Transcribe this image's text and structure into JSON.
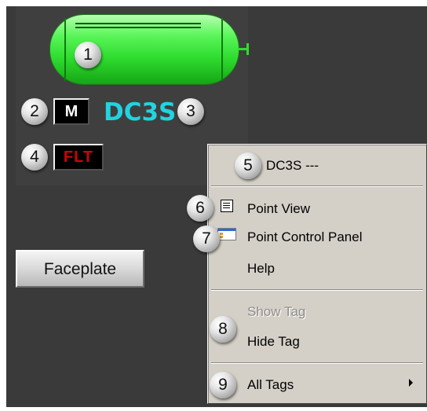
{
  "tank": {
    "color": "#3ee63e",
    "callout": "1"
  },
  "mode": {
    "button_label": "M",
    "callout": "2"
  },
  "tag": {
    "name": "DC3S",
    "color": "#22d3e0",
    "callout": "3"
  },
  "fault": {
    "button_label": "FLT",
    "text_color": "#d40000",
    "callout": "4"
  },
  "faceplate": {
    "label": "Faceplate"
  },
  "context_menu": {
    "title": "DC3S ---",
    "title_callout": "5",
    "point_view": {
      "label": "Point View",
      "callout": "6",
      "icon": "list-view-icon"
    },
    "point_control_panel": {
      "label": "Point Control Panel",
      "callout": "7",
      "icon": "control-panel-icon"
    },
    "help": {
      "label": "Help"
    },
    "show_tag": {
      "label": "Show Tag",
      "disabled": true
    },
    "hide_tag": {
      "label": "Hide Tag"
    },
    "tag_callout": "8",
    "all_tags": {
      "label": "All Tags",
      "callout": "9",
      "icon": "submenu-arrow-icon"
    }
  }
}
